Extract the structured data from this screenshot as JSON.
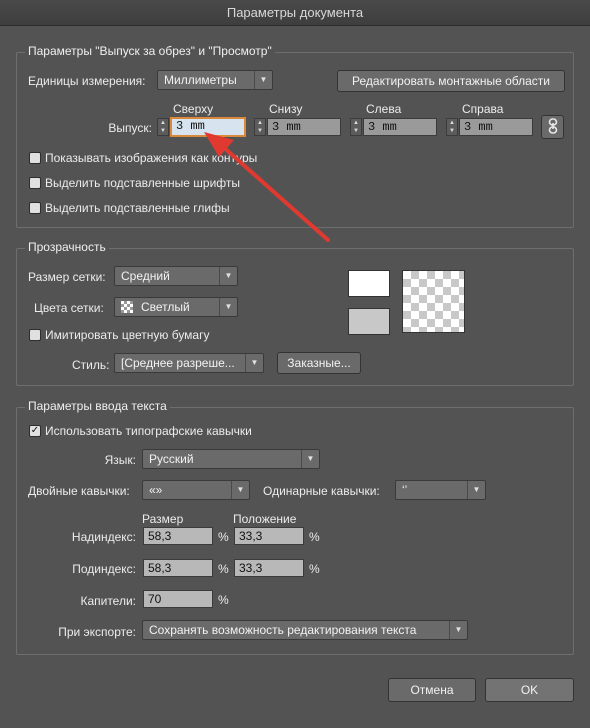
{
  "window": {
    "title": "Параметры документа"
  },
  "bleed_view": {
    "group_title": "Параметры \"Выпуск за обрез\" и \"Просмотр\"",
    "units_label": "Единицы измерения:",
    "units_value": "Миллиметры",
    "edit_artboards_button": "Редактировать монтажные области",
    "bleed_label": "Выпуск:",
    "bleed": {
      "top": {
        "label": "Сверху",
        "value": "3 mm"
      },
      "bottom": {
        "label": "Снизу",
        "value": "3 mm"
      },
      "left": {
        "label": "Слева",
        "value": "3 mm"
      },
      "right": {
        "label": "Справа",
        "value": "3 mm"
      }
    },
    "checkboxes": [
      {
        "label": "Показывать изображения как контуры",
        "checked": false
      },
      {
        "label": "Выделить подставленные шрифты",
        "checked": false
      },
      {
        "label": "Выделить подставленные глифы",
        "checked": false
      }
    ]
  },
  "transparency": {
    "group_title": "Прозрачность",
    "grid_size_label": "Размер сетки:",
    "grid_size_value": "Средний",
    "grid_colors_label": "Цвета сетки:",
    "grid_colors_value": "Светлый",
    "simulate_paper_label": "Имитировать цветную бумагу",
    "simulate_paper_checked": false,
    "style_label": "Стиль:",
    "style_value": "[Среднее разреше...",
    "custom_button": "Заказные...",
    "colors": {
      "swatch_top": "#ffffff",
      "swatch_bottom": "#c8c8c8"
    }
  },
  "type_options": {
    "group_title": "Параметры ввода текста",
    "typographic_quotes_label": "Использовать типографские кавычки",
    "typographic_quotes_checked": true,
    "check_mark": "✓",
    "language_label": "Язык:",
    "language_value": "Русский",
    "double_quotes_label": "Двойные кавычки:",
    "double_quotes_value": "«»",
    "single_quotes_label": "Одинарные кавычки:",
    "single_quotes_value": "‘’",
    "size_header": "Размер",
    "position_header": "Положение",
    "superscript_label": "Надиндекс:",
    "superscript_size": "58,3",
    "superscript_position": "33,3",
    "subscript_label": "Подиндекс:",
    "subscript_size": "58,3",
    "subscript_position": "33,3",
    "small_caps_label": "Капители:",
    "small_caps_value": "70",
    "percent": "%",
    "export_label": "При экспорте:",
    "export_value": "Сохранять возможность редактирования текста"
  },
  "footer": {
    "cancel_button": "Отмена",
    "ok_button": "OK"
  },
  "annotation": {
    "arrow_color": "#e03a30"
  }
}
